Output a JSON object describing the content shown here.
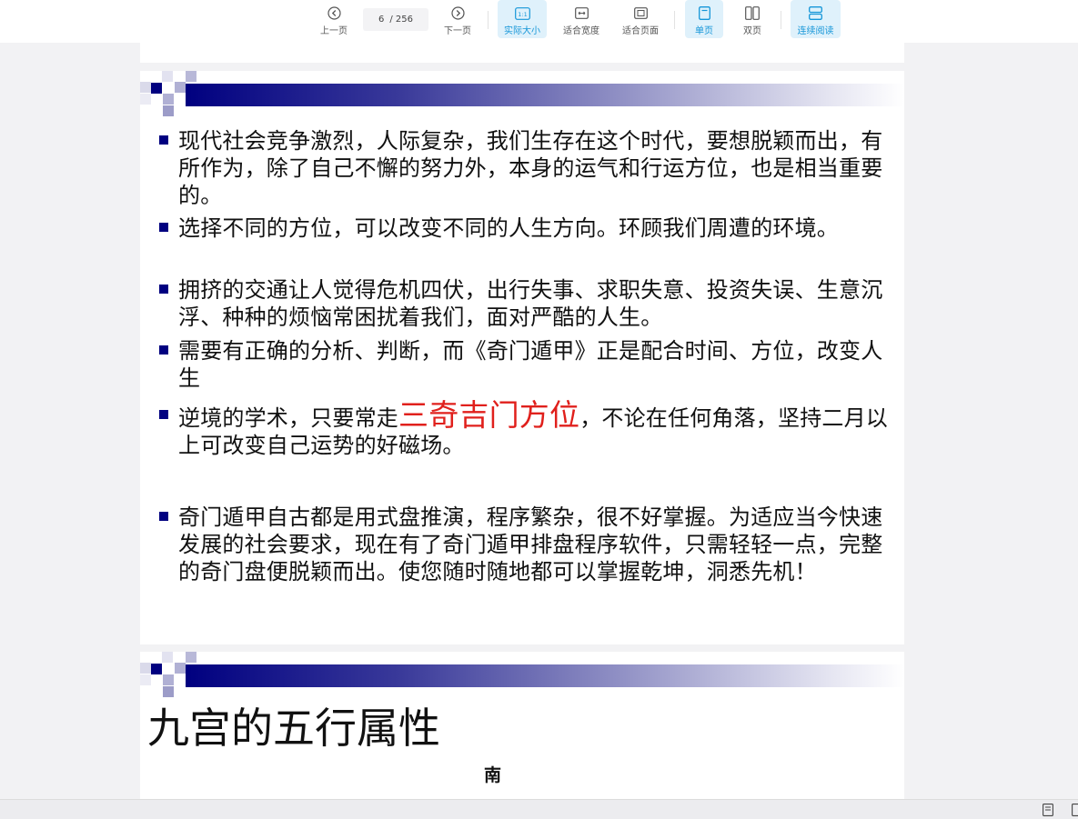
{
  "toolbar": {
    "prev_label": "上一页",
    "next_label": "下一页",
    "current_page": "6",
    "total_pages": "/ 256",
    "actual_size_label": "实际大小",
    "actual_size_icon_text": "1:1",
    "fit_width_label": "适合宽度",
    "fit_page_label": "适合页面",
    "single_page_label": "单页",
    "double_page_label": "双页",
    "continuous_label": "连续阅读",
    "active_color": "#1596d8"
  },
  "slide1": {
    "bullets": [
      {
        "text": "现代社会竞争激烈，人际复杂，我们生存在这个时代，要想脱颖而出，有所作为，除了自己不懈的努力外，本身的运气和行运方位，也是相当重要的。"
      },
      {
        "text": "选择不同的方位，可以改变不同的人生方向。环顾我们周遭的环境。"
      },
      {
        "text": "拥挤的交通让人觉得危机四伏，出行失事、求职失意、投资失误、生意沉浮、种种的烦恼常困扰着我们，面对严酷的人生。"
      },
      {
        "text": "需要有正确的分析、判断，而《奇门遁甲》正是配合时间、方位，改变人生"
      },
      {
        "before": "逆境的学术，只要常走",
        "highlight": "三奇吉门方位",
        "after": "，不论在任何角落，坚持二月以上可改变自己运势的好磁场。"
      },
      {
        "text": "奇门遁甲自古都是用式盘推演，程序繁杂，很不好掌握。为适应当今快速发展的社会要求，现在有了奇门遁甲排盘程序软件，只需轻轻一点，完整的奇门盘便脱颖而出。使您随时随地都可以掌握乾坤，洞悉先机！"
      }
    ],
    "highlight_color": "#e0201c",
    "bullet_color": "#000080"
  },
  "slide2": {
    "title": "九宫的五行属性",
    "south_label": "南"
  }
}
